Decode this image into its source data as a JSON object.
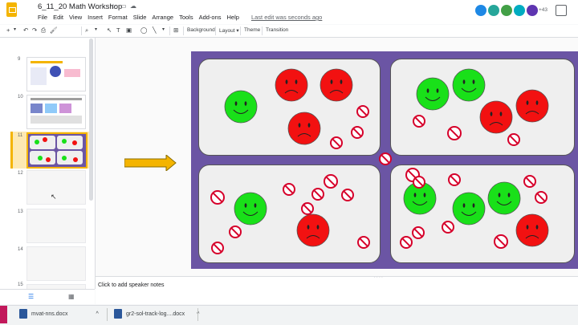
{
  "app": {
    "doc_title": "6_11_20 Math Workshop",
    "menu": [
      "File",
      "Edit",
      "View",
      "Insert",
      "Format",
      "Slide",
      "Arrange",
      "Tools",
      "Add-ons",
      "Help"
    ],
    "last_edit": "Last edit was seconds ago",
    "collaborator_count": "+43"
  },
  "toolbar": {
    "background": "Background",
    "layout": "Layout ▾",
    "theme": "Theme",
    "transition": "Transition"
  },
  "filmstrip": {
    "slides": [
      {
        "num": "9",
        "state": "normal"
      },
      {
        "num": "10",
        "state": "normal"
      },
      {
        "num": "11",
        "state": "selected"
      },
      {
        "num": "12",
        "state": "faded"
      },
      {
        "num": "13",
        "state": "faded"
      },
      {
        "num": "14",
        "state": "faded"
      },
      {
        "num": "15",
        "state": "faded"
      }
    ]
  },
  "notes": {
    "placeholder": "Click to add speaker notes"
  },
  "taskbar": {
    "items": [
      "mvat-nns.docx",
      "gr2-sol-track-log....docx"
    ]
  },
  "colors": {
    "accent": "#f4b400",
    "slide_bg": "#6b55a4",
    "happy": "#19e019",
    "sad": "#f21111",
    "no_sign": "#d6002a"
  }
}
